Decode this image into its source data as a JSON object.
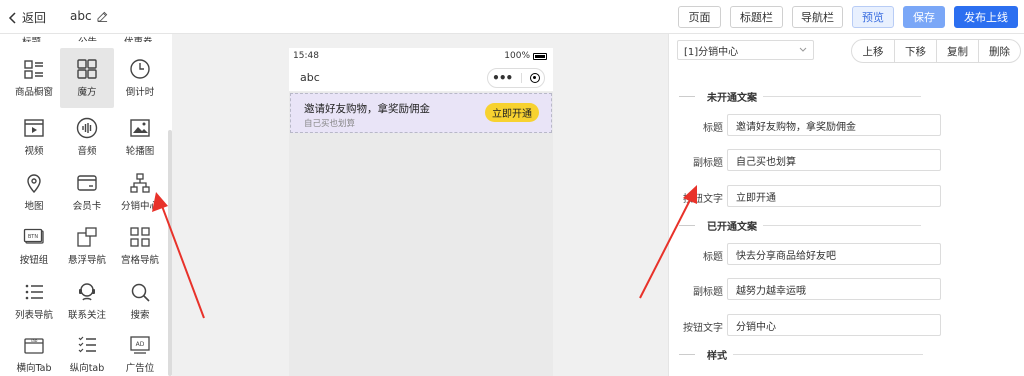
{
  "header": {
    "back_label": "返回",
    "page_name": "abc",
    "buttons": {
      "page": "页面",
      "title_bar": "标题栏",
      "nav_bar": "导航栏",
      "preview": "预览",
      "save": "保存",
      "publish": "发布上线"
    }
  },
  "components": {
    "top_partial": [
      "标题",
      "公告",
      "优惠券"
    ],
    "items": [
      {
        "label": "商品橱窗",
        "icon": "showcase-icon"
      },
      {
        "label": "魔方",
        "icon": "cube-grid-icon",
        "active": true
      },
      {
        "label": "倒计时",
        "icon": "clock-icon"
      },
      {
        "label": "视频",
        "icon": "video-icon"
      },
      {
        "label": "音频",
        "icon": "audio-icon"
      },
      {
        "label": "轮播图",
        "icon": "image-icon"
      },
      {
        "label": "地图",
        "icon": "map-pin-icon"
      },
      {
        "label": "会员卡",
        "icon": "member-card-icon"
      },
      {
        "label": "分销中心",
        "icon": "distribution-icon"
      },
      {
        "label": "按钮组",
        "icon": "button-group-icon"
      },
      {
        "label": "悬浮导航",
        "icon": "float-nav-icon"
      },
      {
        "label": "宫格导航",
        "icon": "grid-nav-icon"
      },
      {
        "label": "列表导航",
        "icon": "list-nav-icon"
      },
      {
        "label": "联系关注",
        "icon": "contact-icon"
      },
      {
        "label": "搜索",
        "icon": "search-icon"
      },
      {
        "label": "横向Tab",
        "icon": "tab-icon"
      },
      {
        "label": "纵向tab",
        "icon": "vertical-tab-icon"
      },
      {
        "label": "广告位",
        "icon": "ad-icon"
      }
    ]
  },
  "phone": {
    "time": "15:48",
    "battery": "100%",
    "title": "abc",
    "banner": {
      "title": "邀请好友购物，拿奖励佣金",
      "subtitle": "自己买也划算",
      "button": "立即开通"
    }
  },
  "inspector": {
    "selected_component": "[1]分销中心",
    "actions": {
      "up": "上移",
      "down": "下移",
      "copy": "复制",
      "delete": "删除"
    },
    "section_inactive": "未开通文案",
    "section_active": "已开通文案",
    "section_style": "样式",
    "labels": {
      "title": "标题",
      "subtitle": "副标题",
      "button_text": "按钮文字"
    },
    "inactive": {
      "title": "邀请好友购物，拿奖励佣金",
      "subtitle": "自己买也划算",
      "button_text": "立即开通"
    },
    "active": {
      "title": "快去分享商品给好友吧",
      "subtitle": "越努力越幸运哦",
      "button_text": "分销中心"
    }
  },
  "colors": {
    "publish": "#2c6ff0",
    "save": "#7aa7f7",
    "banner_bg": "#e9e4f7",
    "banner_button": "#f7d230",
    "arrow": "#e8322a"
  }
}
